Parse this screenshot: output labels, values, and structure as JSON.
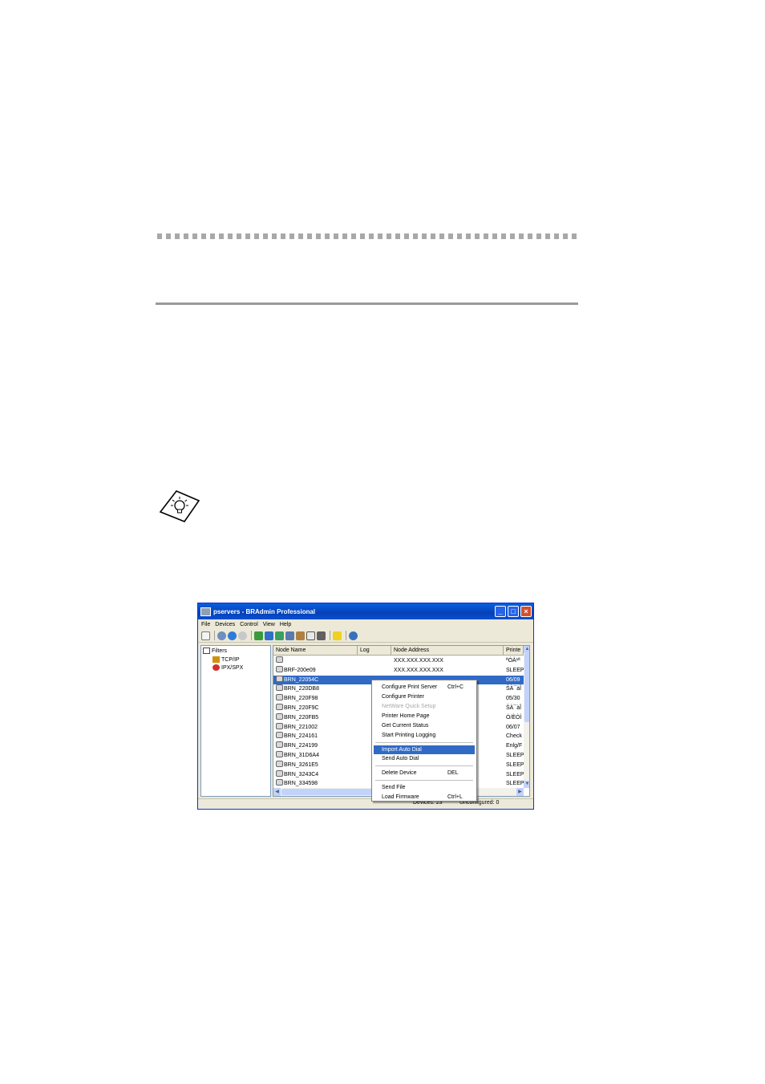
{
  "window": {
    "title": "pservers - BRAdmin Professional",
    "minimize_glyph": "_",
    "maximize_glyph": "□",
    "close_glyph": "×"
  },
  "menu": [
    "File",
    "Devices",
    "Control",
    "View",
    "Help"
  ],
  "tree": {
    "root": "Filters",
    "children": [
      "TCP/IP",
      "IPX/SPX"
    ]
  },
  "list": {
    "columns": [
      "Node Name",
      "Log",
      "Node Address",
      "Printe"
    ],
    "rows": [
      {
        "name": "",
        "address": "XXX.XXX.XXX.XXX",
        "status": "ªÓÀ¹ª"
      },
      {
        "name": "BRF-200e09",
        "address": "XXX.XXX.XXX.XXX",
        "status": "SLEEP"
      },
      {
        "name": "BRN_22054C",
        "address": "",
        "status": "06/09"
      },
      {
        "name": "BRN_220DB8",
        "address": "",
        "status": "ŠÀ¯àÎ"
      },
      {
        "name": "BRN_220F98",
        "address": "",
        "status": "05/30"
      },
      {
        "name": "BRN_220F9C",
        "address": "",
        "status": "ŠÀ¯àÎ"
      },
      {
        "name": "BRN_220FB5",
        "address": "",
        "status": "Ó/ÈÒÌ"
      },
      {
        "name": "BRN_221002",
        "address": "",
        "status": "06/07"
      },
      {
        "name": "BRN_224161",
        "address": "",
        "status": "Check"
      },
      {
        "name": "BRN_224199",
        "address": "",
        "status": "Enlg/F"
      },
      {
        "name": "BRN_31D6A4",
        "address": "",
        "status": "SLEEP"
      },
      {
        "name": "BRN_3261E5",
        "address": "",
        "status": "SLEEP"
      },
      {
        "name": "BRN_3243C4",
        "address": "",
        "status": "SLEEP"
      },
      {
        "name": "BRN_334598",
        "address": "",
        "status": "SLEEP"
      }
    ]
  },
  "context_menu": {
    "items": [
      {
        "label": "Configure Print Server",
        "shortcut": "Ctrl+C"
      },
      {
        "label": "Configure Printer",
        "shortcut": ""
      },
      {
        "label": "NetWare Quick Setup",
        "shortcut": ""
      },
      {
        "label": "Printer Home Page",
        "shortcut": ""
      },
      {
        "label": "Get Current Status",
        "shortcut": ""
      },
      {
        "label": "Start Printing Logging",
        "shortcut": ""
      },
      {
        "label": "Import Auto Dial",
        "shortcut": ""
      },
      {
        "label": "Send Auto Dial",
        "shortcut": ""
      },
      {
        "label": "Delete Device",
        "shortcut": "DEL"
      },
      {
        "label": "Send File",
        "shortcut": ""
      },
      {
        "label": "Load Firmware",
        "shortcut": "Ctrl+L"
      }
    ]
  },
  "status": {
    "devices": "Devices: 23",
    "unconfigured": "Unconfigured: 0"
  },
  "colors": {
    "titlebar": "#0a5fe0",
    "selection": "#316ac5"
  }
}
